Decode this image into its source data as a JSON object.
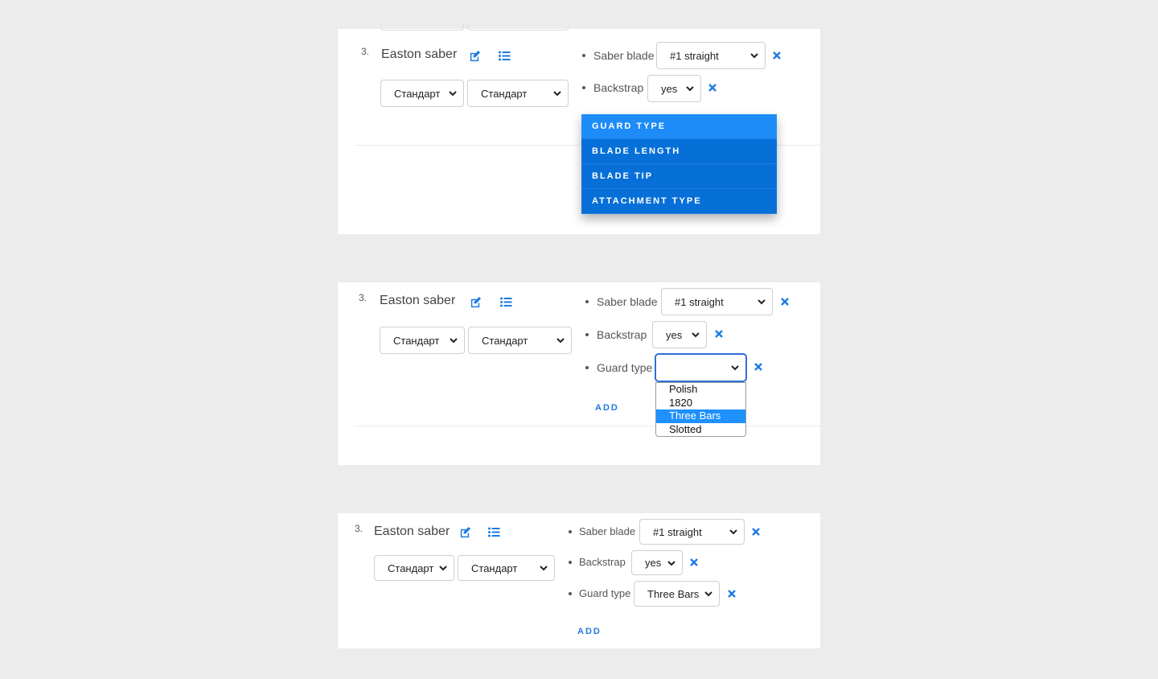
{
  "colors": {
    "accent": "#1e7be0",
    "menu_bg": "#0770d8",
    "menu_highlight": "#1d8cf8",
    "option_highlight": "#1e90ff"
  },
  "panels": [
    {
      "index": "3.",
      "title": "Easton saber",
      "selects": [
        "Стандарт",
        "Стандарт"
      ],
      "attributes": [
        {
          "label": "Saber blade",
          "value": "#1 straight"
        },
        {
          "label": "Backstrap",
          "value": "yes"
        }
      ],
      "menu": [
        "GUARD TYPE",
        "BLADE LENGTH",
        "BLADE TIP",
        "ATTACHMENT TYPE"
      ]
    },
    {
      "index": "3.",
      "title": "Easton saber",
      "selects": [
        "Стандарт",
        "Стандарт"
      ],
      "attributes": [
        {
          "label": "Saber blade",
          "value": "#1 straight"
        },
        {
          "label": "Backstrap",
          "value": "yes"
        },
        {
          "label": "Guard type",
          "value": ""
        }
      ],
      "dropdown_options": [
        "Polish",
        "1820",
        "Three Bars",
        "Slotted"
      ],
      "dropdown_selected": "Three Bars",
      "add_label": "ADD"
    },
    {
      "index": "3.",
      "title": "Easton saber",
      "selects": [
        "Стандарт",
        "Стандарт"
      ],
      "attributes": [
        {
          "label": "Saber blade",
          "value": "#1 straight"
        },
        {
          "label": "Backstrap",
          "value": "yes"
        },
        {
          "label": "Guard type",
          "value": "Three Bars"
        }
      ],
      "add_label": "ADD"
    }
  ]
}
